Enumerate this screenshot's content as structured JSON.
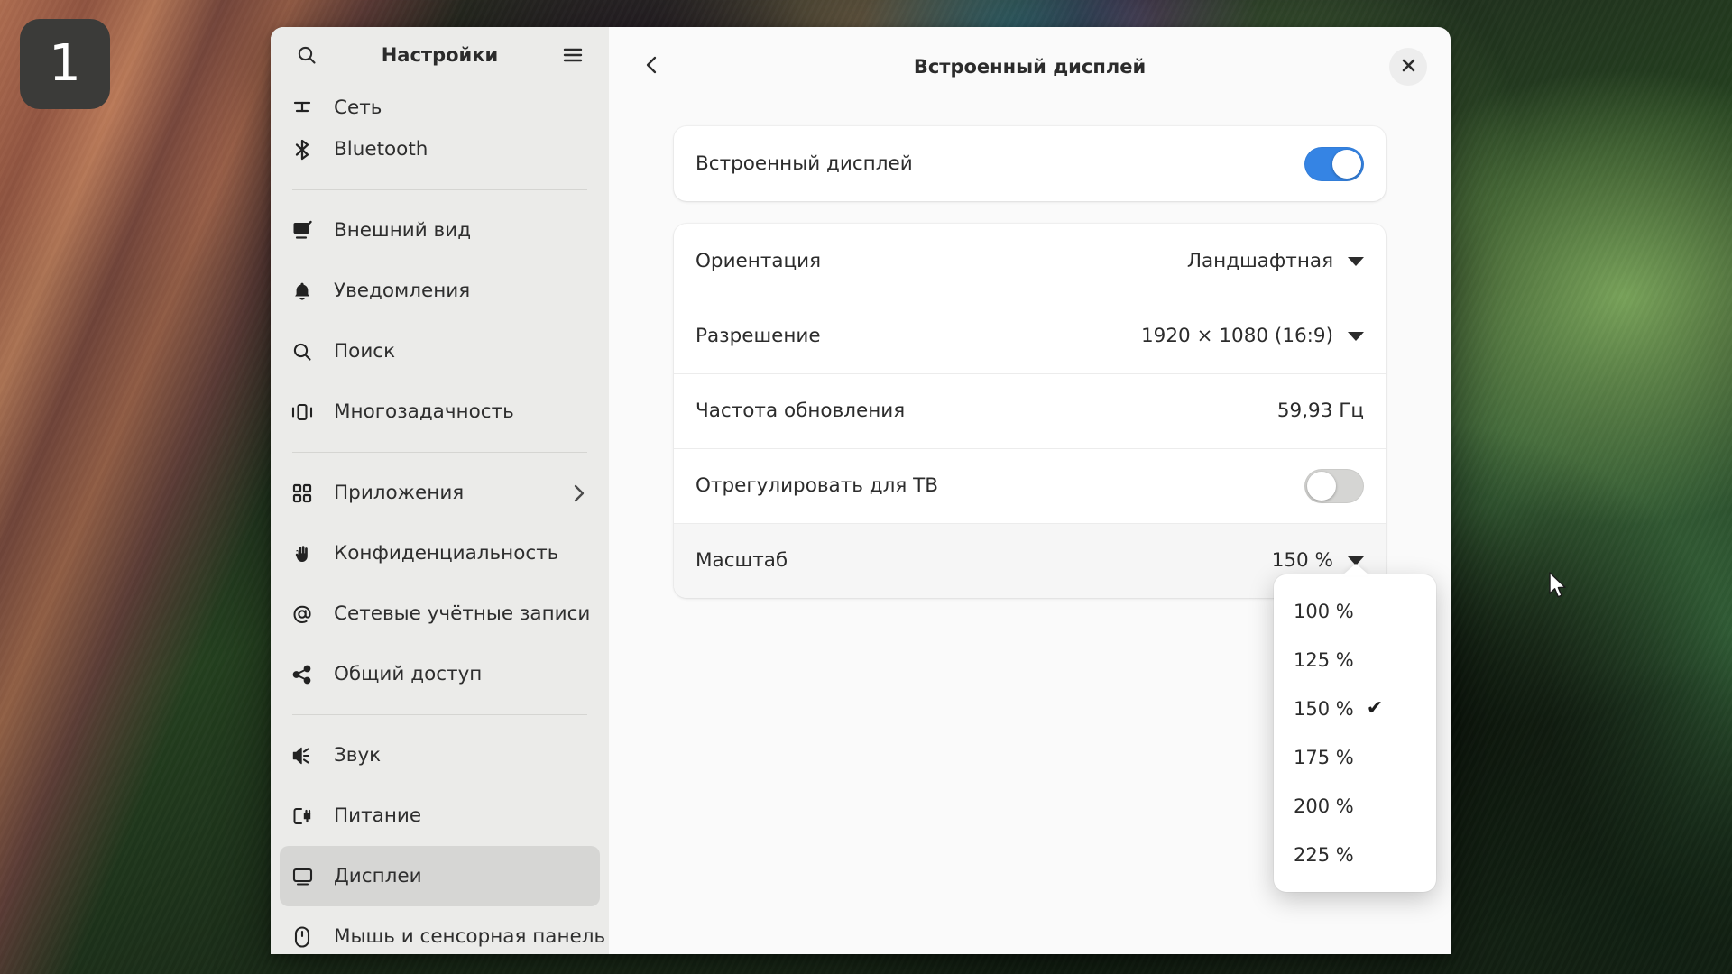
{
  "desktop": {
    "workspace_badge": "1",
    "cursor_icon": "arrow-pointer-icon"
  },
  "sidebar": {
    "title": "Настройки",
    "search_icon": "search-icon",
    "menu_icon": "hamburger-menu-icon",
    "groups": [
      {
        "items": [
          {
            "label": "Сеть",
            "icon": "network-icon",
            "clipped": true
          },
          {
            "label": "Bluetooth",
            "icon": "bluetooth-icon"
          }
        ]
      },
      {
        "items": [
          {
            "label": "Внешний вид",
            "icon": "appearance-icon"
          },
          {
            "label": "Уведомления",
            "icon": "bell-icon"
          },
          {
            "label": "Поиск",
            "icon": "search-icon"
          },
          {
            "label": "Многозадачность",
            "icon": "multitasking-icon"
          }
        ]
      },
      {
        "items": [
          {
            "label": "Приложения",
            "icon": "apps-grid-icon",
            "chevron": true
          },
          {
            "label": "Конфиденциальность",
            "icon": "hand-icon"
          },
          {
            "label": "Сетевые учётные записи",
            "icon": "at-sign-icon"
          },
          {
            "label": "Общий доступ",
            "icon": "share-icon"
          }
        ]
      },
      {
        "items": [
          {
            "label": "Звук",
            "icon": "speaker-icon"
          },
          {
            "label": "Питание",
            "icon": "power-plug-icon"
          },
          {
            "label": "Дисплеи",
            "icon": "display-icon",
            "selected": true
          },
          {
            "label": "Мышь и сенсорная панель",
            "icon": "mouse-icon"
          }
        ]
      }
    ]
  },
  "content": {
    "title": "Встроенный дисплей",
    "back_icon": "chevron-left-icon",
    "close_icon": "close-icon",
    "enable_card": {
      "label": "Встроенный дисплей",
      "toggle_state": "on"
    },
    "rows": [
      {
        "label": "Ориентация",
        "value": "Ландшафтная",
        "type": "dropdown"
      },
      {
        "label": "Разрешение",
        "value": "1920 × 1080 (16:9)",
        "type": "dropdown"
      },
      {
        "label": "Частота обновления",
        "value": "59,93 Гц",
        "type": "text"
      },
      {
        "label": "Отрегулировать для ТВ",
        "value": "",
        "type": "toggle",
        "toggle_state": "off"
      },
      {
        "label": "Масштаб",
        "value": "150 %",
        "type": "dropdown",
        "active": true
      }
    ]
  },
  "scale_popover": {
    "options": [
      {
        "label": "100 %",
        "checked": false
      },
      {
        "label": "125 %",
        "checked": false
      },
      {
        "label": "150 %",
        "checked": true
      },
      {
        "label": "175 %",
        "checked": false
      },
      {
        "label": "200 %",
        "checked": false
      },
      {
        "label": "225 %",
        "checked": false
      }
    ],
    "check_glyph": "✔"
  },
  "colors": {
    "accent": "#3584e4",
    "sidebar_bg": "#ebebe9",
    "content_bg": "#fafafa",
    "selected_row": "#d6d6d4",
    "badge_bg": "#3b3b39"
  }
}
